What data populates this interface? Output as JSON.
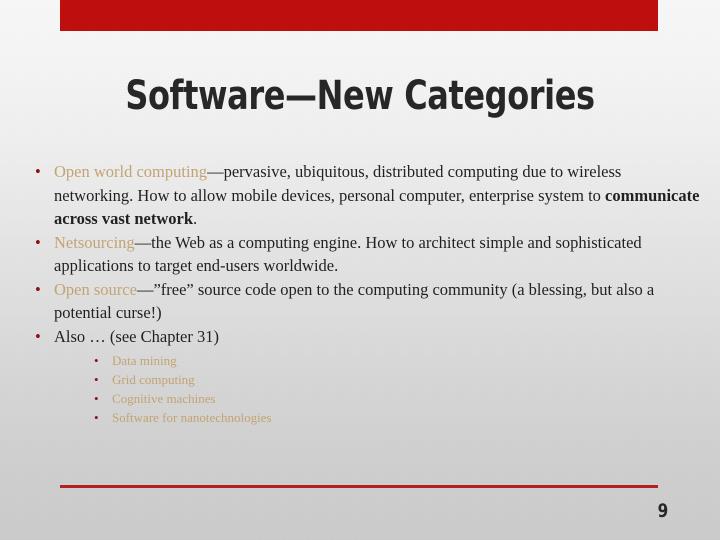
{
  "slide": {
    "title": "Software—New Categories",
    "page_number": "9",
    "accent_bar_color": "#bf0d0d",
    "rule_color": "#b3201f",
    "highlight_color": "#c3a474",
    "bullet_marker_color": "#8f1111",
    "text_color": "#1f1f1f",
    "bullet_glyph": "•"
  },
  "bullets": [
    {
      "lead": "Open world computing",
      "mid": "—pervasive, ubiquitous, distributed computing due to wireless networking. How to allow mobile devices, personal computer, enterprise system to ",
      "strong": "communicate across vast network",
      "tail": "."
    },
    {
      "lead": "Netsourcing",
      "mid": "—the Web as a computing engine. How to architect simple and sophisticated applications to target end-users worldwide.",
      "strong": "",
      "tail": ""
    },
    {
      "lead": "Open source",
      "mid": "—”free” source code open to the computing community (a blessing, but also a potential curse!)",
      "strong": "",
      "tail": ""
    },
    {
      "lead": "",
      "mid": "Also … (see Chapter 31)",
      "strong": "",
      "tail": ""
    }
  ],
  "sub_bullets": [
    {
      "label": "Data mining"
    },
    {
      "label": "Grid computing"
    },
    {
      "label": "Cognitive machines"
    },
    {
      "label": "Software for nanotechnologies"
    }
  ]
}
